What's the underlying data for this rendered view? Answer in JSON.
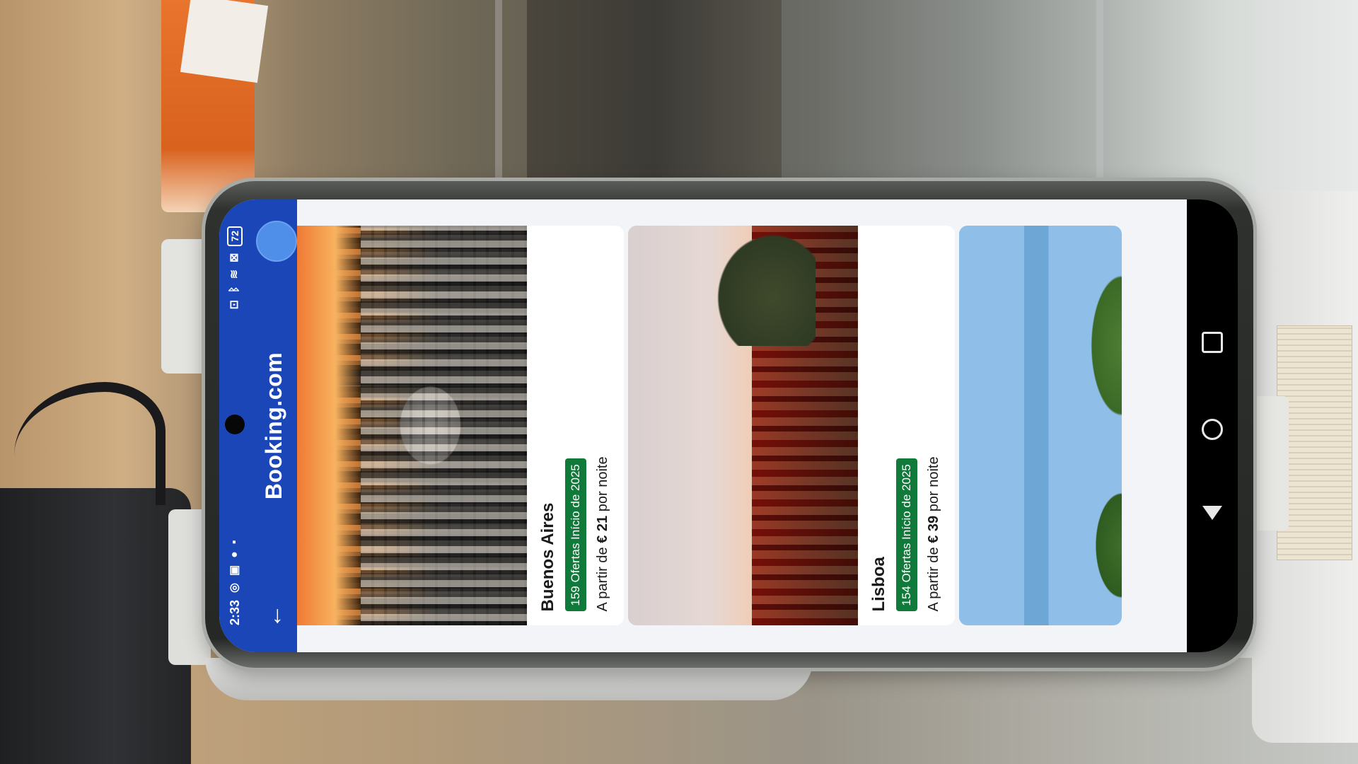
{
  "statusbar": {
    "time": "2:33",
    "battery": "72"
  },
  "appbar": {
    "brand": "Booking.com"
  },
  "cards": [
    {
      "city": "Buenos Aires",
      "deals": "159 Ofertas Início de 2025",
      "price_prefix": "A partir de",
      "price": "€ 21",
      "price_suffix": "por noite"
    },
    {
      "city": "Lisboa",
      "deals": "154 Ofertas Início de 2025",
      "price_prefix": "A partir de",
      "price": "€ 39",
      "price_suffix": "por noite"
    }
  ],
  "colors": {
    "brand_blue": "#1a46b8",
    "deal_green": "#0f7a3a"
  },
  "icons": {
    "back": "arrow-left-icon",
    "avatar": "profile-avatar"
  }
}
